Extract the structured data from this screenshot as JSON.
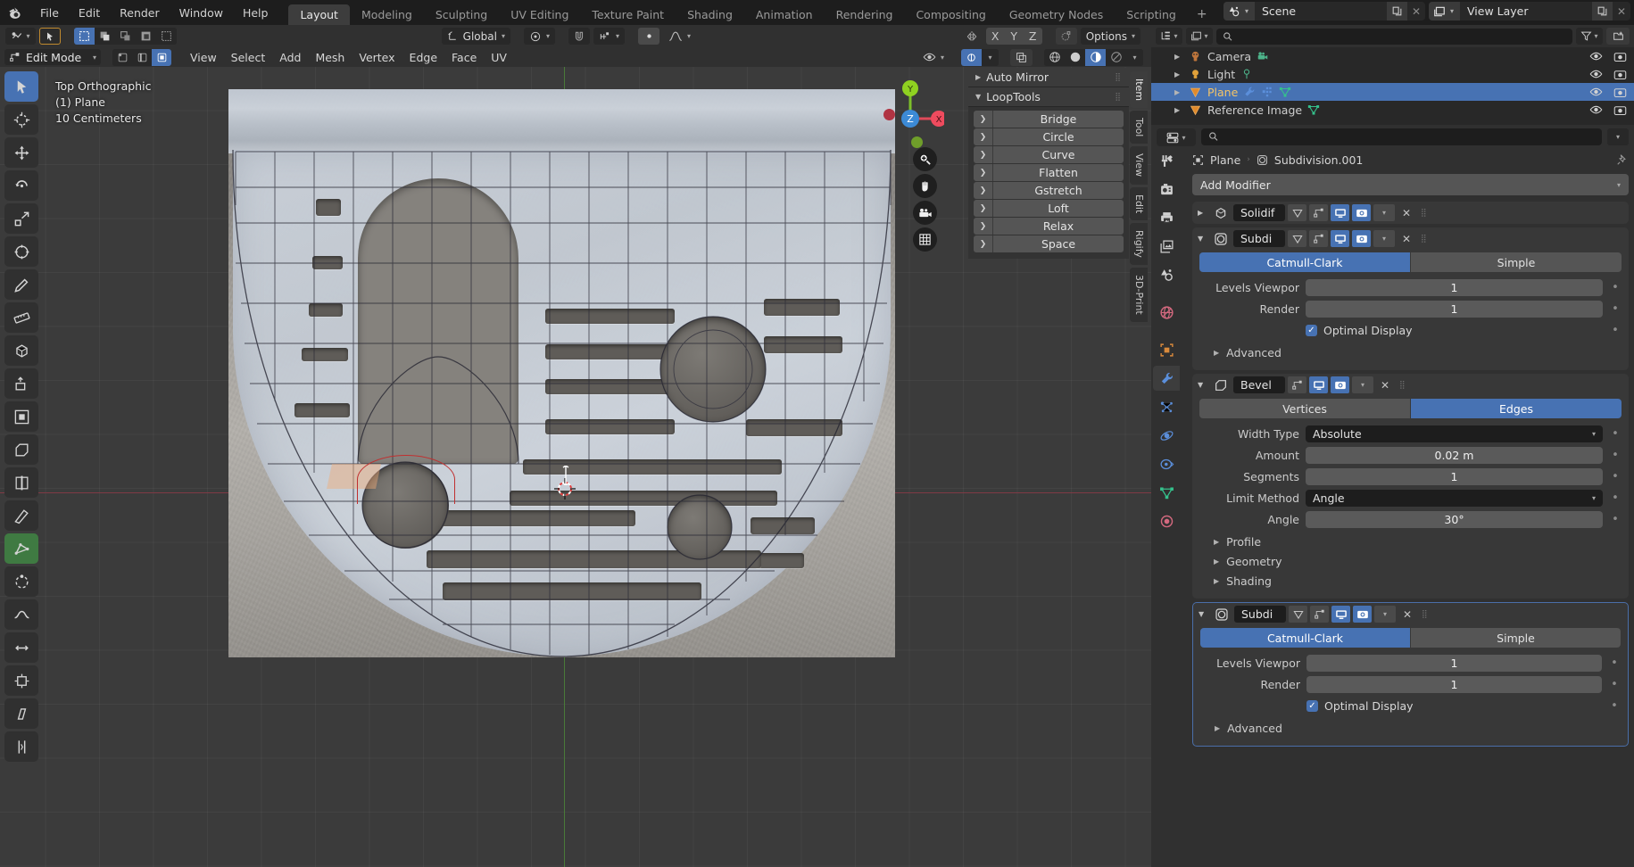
{
  "app": {
    "title": "Blender",
    "logo_icon": "blender-logo-icon"
  },
  "topbar": {
    "menus": [
      "File",
      "Edit",
      "Render",
      "Window",
      "Help"
    ],
    "workspace_tabs": [
      {
        "label": "Layout",
        "active": true
      },
      {
        "label": "Modeling",
        "active": false
      },
      {
        "label": "Sculpting",
        "active": false
      },
      {
        "label": "UV Editing",
        "active": false
      },
      {
        "label": "Texture Paint",
        "active": false
      },
      {
        "label": "Shading",
        "active": false
      },
      {
        "label": "Animation",
        "active": false
      },
      {
        "label": "Rendering",
        "active": false
      },
      {
        "label": "Compositing",
        "active": false
      },
      {
        "label": "Geometry Nodes",
        "active": false
      },
      {
        "label": "Scripting",
        "active": false
      }
    ],
    "add_workspace_label": "+",
    "scene": {
      "icon": "scene-icon",
      "name": "Scene",
      "new_icon": "copy-icon",
      "unlink_icon": "x-icon"
    },
    "view_layer": {
      "icon": "view-layer-icon",
      "name": "View Layer",
      "new_icon": "copy-icon",
      "unlink_icon": "x-icon"
    }
  },
  "viewport_header": {
    "editor_type_icon": "editor-type-icon",
    "select_tool_icon": "tweak-select-icon",
    "select_modes": [
      "select-new-icon",
      "select-extend-icon",
      "select-subtract-icon",
      "select-invert-icon",
      "select-intersect-icon"
    ],
    "transform_orientation": {
      "label": "Global",
      "icon": "orientation-icon"
    },
    "pivot_icon": "pivot-point-icon",
    "snap_icon": "snap-magnet-icon",
    "snap_to_icon": "snap-increment-icon",
    "proportional_icon": "proportional-edit-icon",
    "proportional_falloff_icon": "falloff-curve-icon",
    "mirror_label_x": "X",
    "mirror_label_y": "Y",
    "mirror_label_z": "Z",
    "mirror_icon": "mirror-icon",
    "automerge_icon": "automerge-icon",
    "options_label": "Options"
  },
  "viewport_header2": {
    "mode": "Edit Mode",
    "mode_icon": "edit-mode-icon",
    "mesh_select_modes": [
      "vertex-select-icon",
      "edge-select-icon",
      "face-select-icon"
    ],
    "mesh_select_active_index": 2,
    "menus": [
      "View",
      "Select",
      "Add",
      "Mesh",
      "Vertex",
      "Edge",
      "Face",
      "UV"
    ],
    "visibility_icon": "eye-dropdown-icon",
    "gizmo_icon": "gizmo-icon",
    "overlays_icon": "overlays-icon",
    "xray_icon": "xray-icon",
    "shading_modes": [
      "wireframe-shading-icon",
      "solid-shading-icon",
      "material-shading-icon",
      "rendered-shading-icon"
    ],
    "shading_active_index": 2
  },
  "viewport_overlay": {
    "view_name": "Top Orthographic",
    "collection_object": "(1) Plane",
    "grid_scale": "10 Centimeters"
  },
  "gizmo": {
    "axis_x": "X",
    "axis_y": "Y",
    "axis_z": "Z",
    "nav_buttons": [
      "zoom-icon",
      "pan-hand-icon",
      "camera-view-icon",
      "toggle-ortho-grid-icon"
    ]
  },
  "toolbar": {
    "tools": [
      {
        "name": "tweak-tool",
        "icon": "cursor-arrow-icon",
        "active": true
      },
      {
        "name": "cursor-tool",
        "icon": "3d-cursor-icon",
        "active": false
      },
      {
        "name": "move-tool",
        "icon": "move-arrows-icon",
        "active": false
      },
      {
        "name": "rotate-tool",
        "icon": "rotate-icon",
        "active": false
      },
      {
        "name": "scale-tool",
        "icon": "scale-icon",
        "active": false
      },
      {
        "name": "transform-tool",
        "icon": "transform-icon",
        "active": false
      },
      {
        "name": "annotate-tool",
        "icon": "pencil-icon",
        "active": false
      },
      {
        "name": "measure-tool",
        "icon": "ruler-icon",
        "active": false
      },
      {
        "name": "add-cube-tool",
        "icon": "add-cube-icon",
        "active": false
      },
      {
        "name": "extrude-region-tool",
        "icon": "extrude-icon",
        "active": false
      },
      {
        "name": "inset-faces-tool",
        "icon": "inset-faces-icon",
        "active": false
      },
      {
        "name": "bevel-tool",
        "icon": "bevel-icon",
        "active": false
      },
      {
        "name": "loop-cut-tool",
        "icon": "loop-cut-icon",
        "active": false
      },
      {
        "name": "knife-tool",
        "icon": "knife-icon",
        "active": false
      },
      {
        "name": "poly-build-tool",
        "icon": "poly-build-icon",
        "active": true
      },
      {
        "name": "spin-tool",
        "icon": "spin-icon",
        "active": false
      },
      {
        "name": "smooth-tool",
        "icon": "smooth-icon",
        "active": false
      },
      {
        "name": "edge-slide-tool",
        "icon": "edge-slide-icon",
        "active": false
      },
      {
        "name": "shrink-fatten-tool",
        "icon": "shrink-fatten-icon",
        "active": false
      },
      {
        "name": "shear-tool",
        "icon": "shear-icon",
        "active": false
      },
      {
        "name": "rip-region-tool",
        "icon": "rip-region-icon",
        "active": false
      }
    ]
  },
  "npanel": {
    "vertical_tabs": [
      {
        "label": "Item",
        "active": true
      },
      {
        "label": "Tool",
        "active": false
      },
      {
        "label": "View",
        "active": false
      },
      {
        "label": "Edit",
        "active": false
      },
      {
        "label": "Rigify",
        "active": false
      },
      {
        "label": "3D-Print",
        "active": false
      }
    ],
    "sections": [
      {
        "title": "Auto Mirror",
        "expanded": false,
        "items": []
      },
      {
        "title": "LoopTools",
        "expanded": true,
        "items": [
          "Bridge",
          "Circle",
          "Curve",
          "Flatten",
          "Gstretch",
          "Loft",
          "Relax",
          "Space"
        ]
      }
    ]
  },
  "outliner": {
    "display_mode_icon": "outliner-display-icon",
    "filter_id_icon": "id-type-filter-icon",
    "search_placeholder": "",
    "search_value": "",
    "filter_icon": "funnel-filter-icon",
    "new_collection_icon": "new-collection-icon",
    "rows": [
      {
        "name": "Camera",
        "icon": "camera-object-icon",
        "data_icons": [
          "camera-data-icon"
        ],
        "selected": false,
        "visible_icon": "eye-icon",
        "render_icon": "camera-render-icon"
      },
      {
        "name": "Light",
        "icon": "light-object-icon",
        "data_icons": [
          "light-data-icon"
        ],
        "selected": false,
        "visible_icon": "eye-icon",
        "render_icon": "camera-render-icon"
      },
      {
        "name": "Plane",
        "icon": "mesh-object-icon",
        "data_icons": [
          "modifier-wrench-icon",
          "modifier-stack-icon",
          "mesh-data-icon"
        ],
        "selected": true,
        "visible_icon": "eye-icon",
        "render_icon": "camera-render-icon"
      },
      {
        "name": "Reference Image",
        "icon": "mesh-object-icon",
        "data_icons": [
          "mesh-data-icon"
        ],
        "selected": false,
        "visible_icon": "eye-icon",
        "render_icon": "camera-render-icon"
      }
    ]
  },
  "properties": {
    "editor_icon": "properties-editor-icon",
    "search_placeholder": "",
    "search_value": "",
    "tabs": [
      {
        "name": "tool-tab",
        "icon": "tool-screwdriver-wrench-icon",
        "active": false
      },
      {
        "name": "render-tab",
        "icon": "render-camera-back-icon",
        "active": false
      },
      {
        "name": "output-tab",
        "icon": "output-printer-icon",
        "active": false
      },
      {
        "name": "view-layer-tab",
        "icon": "view-layer-images-icon",
        "active": false
      },
      {
        "name": "scene-tab",
        "icon": "scene-cone-sphere-icon",
        "active": false
      },
      {
        "name": "world-tab",
        "icon": "world-globe-icon",
        "active": false
      },
      {
        "name": "object-tab",
        "icon": "object-orange-square-icon",
        "active": false
      },
      {
        "name": "modifier-tab",
        "icon": "modifier-wrench-icon",
        "active": true
      },
      {
        "name": "particles-tab",
        "icon": "particles-icon",
        "active": false
      },
      {
        "name": "physics-tab",
        "icon": "physics-orbit-icon",
        "active": false
      },
      {
        "name": "constraints-tab",
        "icon": "constraints-clamp-icon",
        "active": false
      },
      {
        "name": "data-tab",
        "icon": "mesh-data-green-icon",
        "active": false
      },
      {
        "name": "material-tab",
        "icon": "material-sphere-icon",
        "active": false
      }
    ],
    "breadcrumb": {
      "object_icon": "object-icon",
      "object": "Plane",
      "separator": "›",
      "modifier_icon": "subdivision-icon",
      "modifier": "Subdivision.001",
      "pin_icon": "pin-icon"
    },
    "add_modifier": {
      "label": "Add Modifier",
      "chevron": "chevron-down-icon"
    },
    "modifiers": [
      {
        "name": "Solidif",
        "type_icon": "solidify-icon",
        "expanded": false,
        "boxed": false,
        "toggles": [
          {
            "name": "on-cage-toggle",
            "icon": "edit-mode-cage-icon",
            "on": false
          },
          {
            "name": "edit-mode-toggle",
            "icon": "edit-mode-display-icon",
            "on": false
          },
          {
            "name": "realtime-toggle",
            "icon": "monitor-icon",
            "on": true
          },
          {
            "name": "render-toggle",
            "icon": "camera-icon",
            "on": true
          }
        ],
        "extras_icon": "chevron-down-icon",
        "close_icon": "x-icon",
        "grip_icon": "drag-grip-icon",
        "body": null
      },
      {
        "name": "Subdi",
        "type_icon": "subdivision-icon",
        "expanded": true,
        "boxed": false,
        "toggles": [
          {
            "name": "on-cage-toggle",
            "icon": "edit-mode-cage-icon",
            "on": false
          },
          {
            "name": "edit-mode-toggle",
            "icon": "edit-mode-display-icon",
            "on": false
          },
          {
            "name": "realtime-toggle",
            "icon": "monitor-icon",
            "on": true
          },
          {
            "name": "render-toggle",
            "icon": "camera-icon",
            "on": true
          }
        ],
        "extras_icon": "chevron-down-icon",
        "close_icon": "x-icon",
        "grip_icon": "drag-grip-icon",
        "body": {
          "segmented": {
            "options": [
              "Catmull-Clark",
              "Simple"
            ],
            "active": 0
          },
          "fields": [
            {
              "label": "Levels Viewpor",
              "value": "1",
              "type": "number"
            },
            {
              "label": "Render",
              "value": "1",
              "type": "number"
            }
          ],
          "checkboxes": [
            {
              "label": "Optimal Display",
              "checked": true
            }
          ],
          "expanders": [
            "Advanced"
          ]
        }
      },
      {
        "name": "Bevel",
        "type_icon": "bevel-modifier-icon",
        "expanded": true,
        "boxed": false,
        "toggles": [
          {
            "name": "edit-mode-toggle",
            "icon": "edit-mode-display-icon",
            "on": false
          },
          {
            "name": "realtime-toggle",
            "icon": "monitor-icon",
            "on": true
          },
          {
            "name": "render-toggle",
            "icon": "camera-icon",
            "on": true
          }
        ],
        "extras_icon": "chevron-down-icon",
        "close_icon": "x-icon",
        "grip_icon": "drag-grip-icon",
        "body": {
          "segmented": {
            "options": [
              "Vertices",
              "Edges"
            ],
            "active": 1
          },
          "fields": [
            {
              "label": "Width Type",
              "value": "Absolute",
              "type": "dropdown"
            },
            {
              "label": "Amount",
              "value": "0.02 m",
              "type": "number"
            },
            {
              "label": "Segments",
              "value": "1",
              "type": "number"
            },
            {
              "label": "Limit Method",
              "value": "Angle",
              "type": "dropdown"
            },
            {
              "label": "Angle",
              "value": "30°",
              "type": "number"
            }
          ],
          "checkboxes": [],
          "expanders": [
            "Profile",
            "Geometry",
            "Shading"
          ]
        }
      },
      {
        "name": "Subdi",
        "type_icon": "subdivision-icon",
        "expanded": true,
        "boxed": true,
        "toggles": [
          {
            "name": "on-cage-toggle",
            "icon": "edit-mode-cage-icon",
            "on": false
          },
          {
            "name": "edit-mode-toggle",
            "icon": "edit-mode-display-icon",
            "on": false
          },
          {
            "name": "realtime-toggle",
            "icon": "monitor-icon",
            "on": true
          },
          {
            "name": "render-toggle",
            "icon": "camera-icon",
            "on": true
          }
        ],
        "extras_icon": "chevron-down-icon",
        "close_icon": "x-icon",
        "grip_icon": "drag-grip-icon",
        "body": {
          "segmented": {
            "options": [
              "Catmull-Clark",
              "Simple"
            ],
            "active": 0
          },
          "fields": [
            {
              "label": "Levels Viewpor",
              "value": "1",
              "type": "number"
            },
            {
              "label": "Render",
              "value": "1",
              "type": "number"
            }
          ],
          "checkboxes": [
            {
              "label": "Optimal Display",
              "checked": true
            }
          ],
          "expanders": [
            "Advanced"
          ]
        }
      }
    ]
  },
  "colors": {
    "accent_blue": "#4772b3",
    "editor_bg": "#303030",
    "panel_bg": "#383838",
    "topbar_bg": "#1d1d1d",
    "viewport_bg": "#3b3b3b",
    "selected_text": "#f5c466",
    "axis_x_red": "#803a45",
    "axis_y_green": "#4a7a39"
  }
}
